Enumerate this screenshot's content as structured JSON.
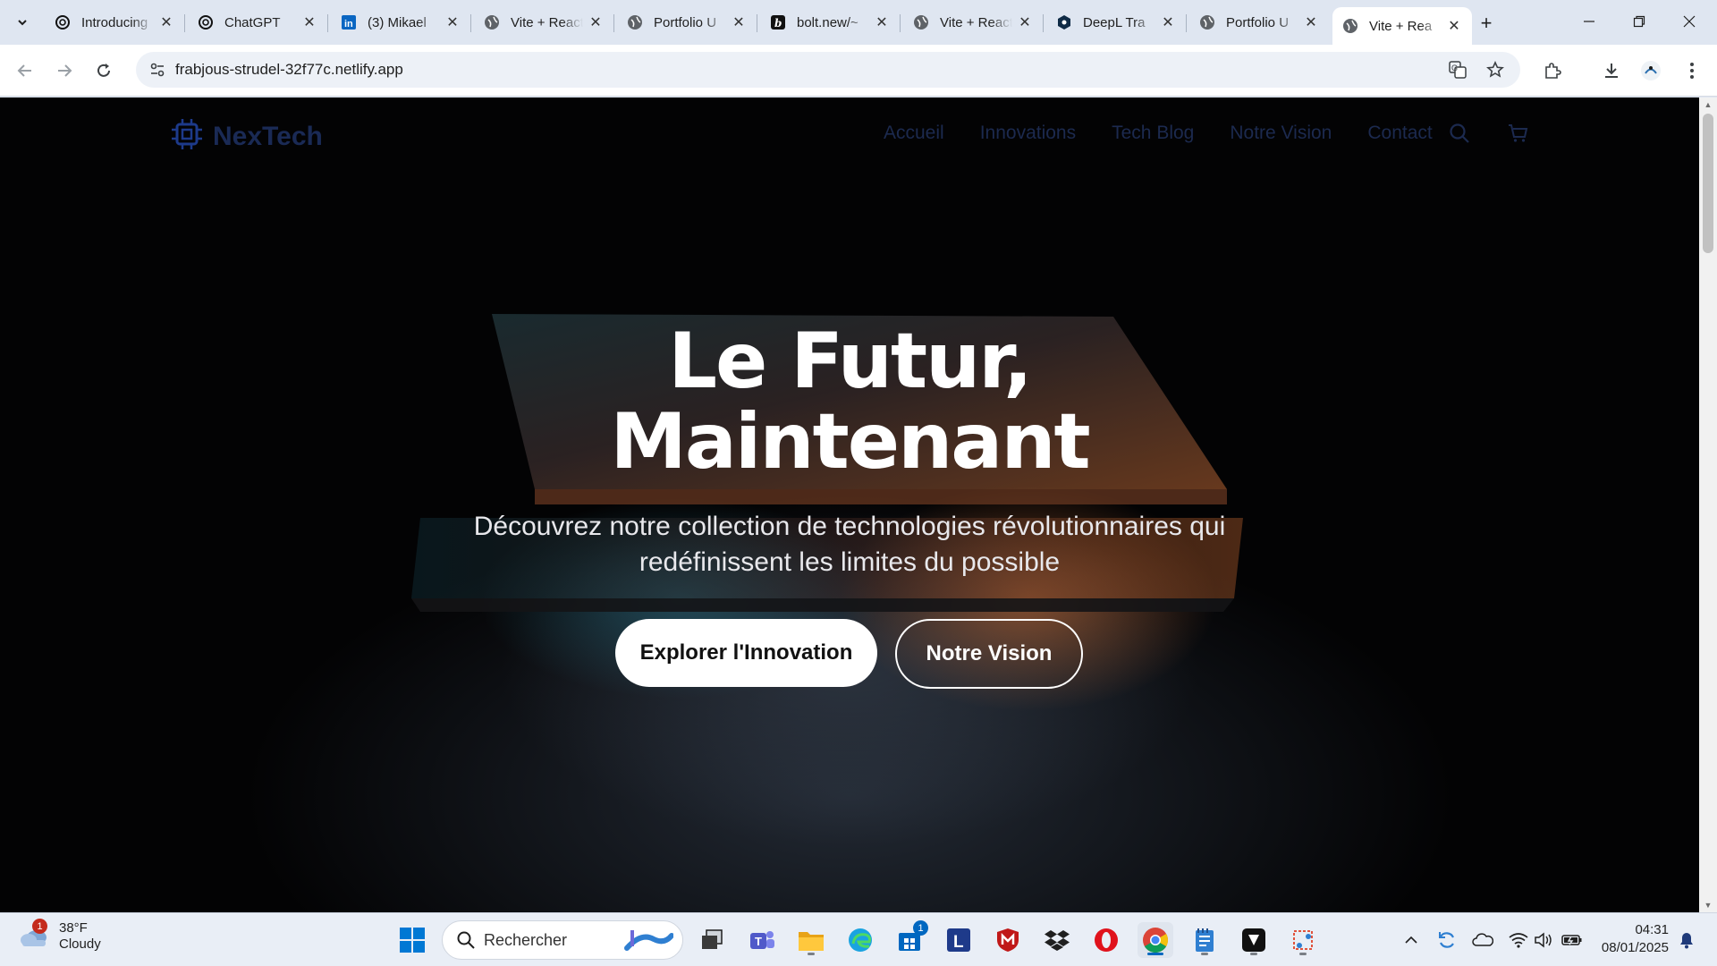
{
  "browser": {
    "tabs": [
      {
        "title": "Introducing",
        "favicon": "openai-icon"
      },
      {
        "title": "ChatGPT",
        "favicon": "openai-icon"
      },
      {
        "title": "(3) Mikael",
        "favicon": "linkedin-icon"
      },
      {
        "title": "Vite + React",
        "favicon": "globe-icon"
      },
      {
        "title": "Portfolio U",
        "favicon": "globe-icon"
      },
      {
        "title": "bolt.new/~",
        "favicon": "bolt-icon"
      },
      {
        "title": "Vite + React",
        "favicon": "globe-icon"
      },
      {
        "title": "DeepL Tra",
        "favicon": "deepl-icon"
      },
      {
        "title": "Portfolio U",
        "favicon": "globe-icon"
      },
      {
        "title": "Vite + Rea",
        "favicon": "globe-icon",
        "active": true
      }
    ],
    "url": "frabjous-strudel-32f77c.netlify.app"
  },
  "site": {
    "brand": "NexTech",
    "nav": [
      "Accueil",
      "Innovations",
      "Tech Blog",
      "Notre Vision",
      "Contact"
    ],
    "hero": {
      "title_line1": "Le Futur,",
      "title_line2": "Maintenant",
      "subtitle": "Découvrez notre collection de technologies révolutionnaires qui redéfinissent les limites du possible",
      "cta_primary": "Explorer l'Innovation",
      "cta_secondary": "Notre Vision"
    },
    "colors": {
      "brand": "#1d3a8a",
      "nav_text": "#1c2a4f",
      "hero_bg": "#030304"
    }
  },
  "taskbar": {
    "weather": {
      "temp": "38°F",
      "condition": "Cloudy",
      "badge": "1"
    },
    "search_placeholder": "Rechercher",
    "store_badge": "1",
    "time": "04:31",
    "date": "08/01/2025"
  }
}
